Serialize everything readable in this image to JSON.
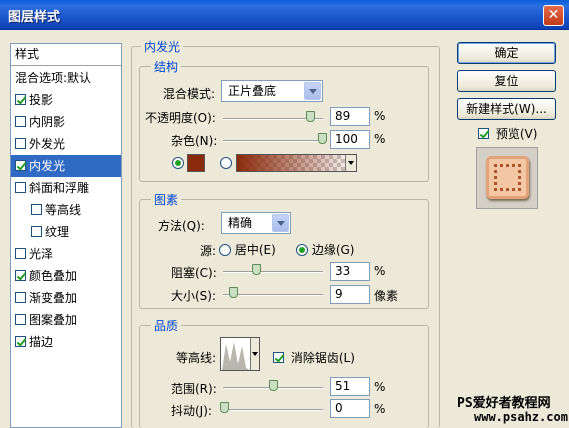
{
  "window": {
    "title": "图层样式",
    "close_glyph": "✕"
  },
  "style_list": {
    "header": "样式",
    "items": [
      {
        "label": "混合选项:默认",
        "checkbox": false,
        "checked": false,
        "indent": false,
        "selected": false
      },
      {
        "label": "投影",
        "checkbox": true,
        "checked": true,
        "indent": false,
        "selected": false
      },
      {
        "label": "内阴影",
        "checkbox": true,
        "checked": false,
        "indent": false,
        "selected": false
      },
      {
        "label": "外发光",
        "checkbox": true,
        "checked": false,
        "indent": false,
        "selected": false
      },
      {
        "label": "内发光",
        "checkbox": true,
        "checked": true,
        "indent": false,
        "selected": true
      },
      {
        "label": "斜面和浮雕",
        "checkbox": true,
        "checked": false,
        "indent": false,
        "selected": false
      },
      {
        "label": "等高线",
        "checkbox": true,
        "checked": false,
        "indent": true,
        "selected": false
      },
      {
        "label": "纹理",
        "checkbox": true,
        "checked": false,
        "indent": true,
        "selected": false
      },
      {
        "label": "光泽",
        "checkbox": true,
        "checked": false,
        "indent": false,
        "selected": false
      },
      {
        "label": "颜色叠加",
        "checkbox": true,
        "checked": true,
        "indent": false,
        "selected": false
      },
      {
        "label": "渐变叠加",
        "checkbox": true,
        "checked": false,
        "indent": false,
        "selected": false
      },
      {
        "label": "图案叠加",
        "checkbox": true,
        "checked": false,
        "indent": false,
        "selected": false
      },
      {
        "label": "描边",
        "checkbox": true,
        "checked": true,
        "indent": false,
        "selected": false
      }
    ]
  },
  "inner_glow": {
    "section_title": "内发光",
    "structure": {
      "title": "结构",
      "blend_mode_label": "混合模式:",
      "blend_mode_value": "正片叠底",
      "opacity_label": "不透明度(O):",
      "opacity_value": "89",
      "opacity_unit": "%",
      "noise_label": "杂色(N):",
      "noise_value": "100",
      "noise_unit": "%",
      "color_swatch": "#8b2a0c"
    },
    "elements": {
      "title": "图素",
      "technique_label": "方法(Q):",
      "technique_value": "精确",
      "source_label": "源:",
      "source_center": "居中(E)",
      "source_edge": "边缘(G)",
      "choke_label": "阻塞(C):",
      "choke_value": "33",
      "choke_unit": "%",
      "size_label": "大小(S):",
      "size_value": "9",
      "size_unit": "像素"
    },
    "quality": {
      "title": "品质",
      "contour_label": "等高线:",
      "antialias_label": "消除锯齿(L)",
      "range_label": "范围(R):",
      "range_value": "51",
      "range_unit": "%",
      "jitter_label": "抖动(J):",
      "jitter_value": "0",
      "jitter_unit": "%"
    }
  },
  "buttons": {
    "ok": "确定",
    "reset": "复位",
    "new_style": "新建样式(W)...",
    "preview_label": "预览(V)"
  },
  "watermark": {
    "line1": "PS爱好者教程网",
    "line2": "www.psahz.com"
  },
  "colors": {
    "accent": "#0046d5",
    "selection": "#316ac5",
    "titlebar": "#0a5fd8"
  }
}
